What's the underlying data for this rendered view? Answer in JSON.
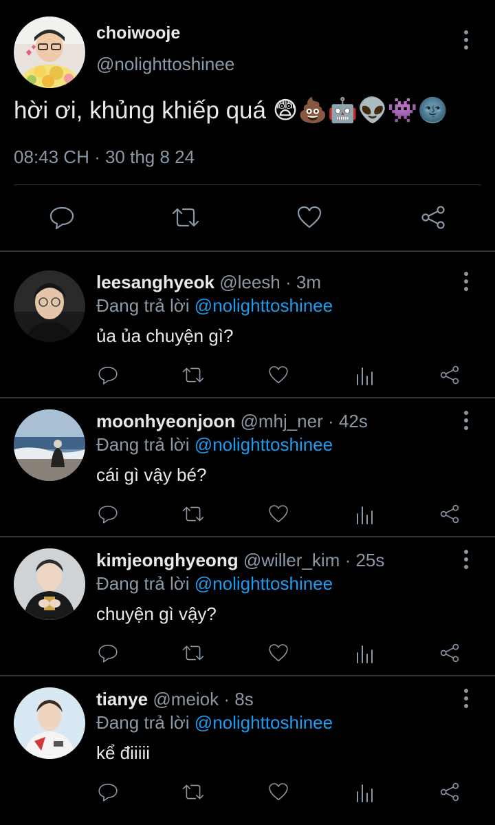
{
  "tweet": {
    "display_name": "choiwooje",
    "handle": "@nolighttoshinee",
    "text": "hời ơi, khủng khiếp quá 😨💩🤖👽👾🌚",
    "timestamp": "08:43 CH · 30 thg 8 24"
  },
  "actions": {
    "reply": "reply-icon",
    "retweet": "retweet-icon",
    "like": "heart-icon",
    "views": "views-icon",
    "share": "share-icon"
  },
  "replies": [
    {
      "name": "leesanghyeok",
      "handle": "@leesh",
      "time": "3m",
      "replying_label": "Đang trả lời",
      "replying_to": "@nolighttoshinee",
      "text": "ủa ủa chuyện gì?"
    },
    {
      "name": "moonhyeonjoon",
      "handle": "@mhj_ner",
      "time": "42s",
      "replying_label": "Đang trả lời",
      "replying_to": "@nolighttoshinee",
      "text": "cái gì vậy bé?"
    },
    {
      "name": "kimjeonghyeong",
      "handle": "@willer_kim",
      "time": "25s",
      "replying_label": "Đang trả lời",
      "replying_to": "@nolighttoshinee",
      "text": "chuyện gì vậy?"
    },
    {
      "name": "tianye",
      "handle": "@meiok",
      "time": "8s",
      "replying_label": "Đang trả lời",
      "replying_to": "@nolighttoshinee",
      "text": "kể điiiii"
    }
  ],
  "colors": {
    "background": "#000000",
    "text": "#e7e9ea",
    "secondary": "#8b98a5",
    "accent": "#1d9bf0",
    "divider": "#2f3336"
  }
}
